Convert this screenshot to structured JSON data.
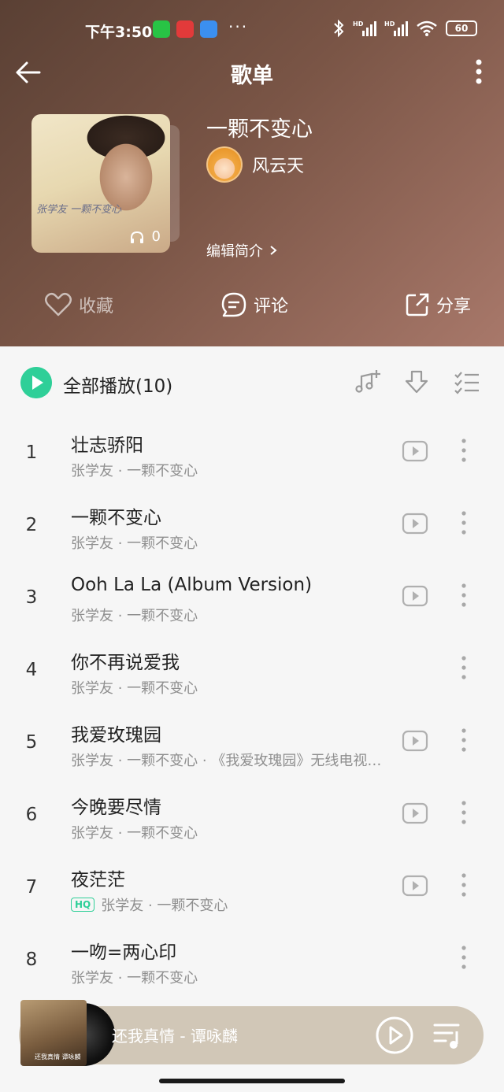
{
  "status": {
    "time": "下午3:50",
    "dots": "···",
    "battery": "60",
    "hd_label": "HD"
  },
  "nav": {
    "title": "歌单"
  },
  "playlist": {
    "title": "一颗不变心",
    "creator": "风云天",
    "edit_intro": "编辑简介",
    "listen_count": "0",
    "cover_sign": "张学友 一颗不变心"
  },
  "actions": {
    "favorite": "收藏",
    "comment": "评论",
    "share": "分享"
  },
  "play_all": {
    "label": "全部播放(10)"
  },
  "songs": [
    {
      "index": "1",
      "title": "壮志骄阳",
      "subtitle": "张学友 · 一颗不变心",
      "hq": false,
      "has_mv": true
    },
    {
      "index": "2",
      "title": "一颗不变心",
      "subtitle": "张学友 · 一颗不变心",
      "hq": false,
      "has_mv": true
    },
    {
      "index": "3",
      "title": "Ooh La La (Album Version)",
      "subtitle": "张学友 · 一颗不变心",
      "hq": false,
      "has_mv": true
    },
    {
      "index": "4",
      "title": "你不再说爱我",
      "subtitle": "张学友 · 一颗不变心",
      "hq": false,
      "has_mv": false
    },
    {
      "index": "5",
      "title": "我爱玫瑰园",
      "subtitle": "张学友 · 一颗不变心 · 《我爱玫瑰园》无线电视…",
      "hq": false,
      "has_mv": true
    },
    {
      "index": "6",
      "title": "今晚要尽情",
      "subtitle": "张学友 · 一颗不变心",
      "hq": false,
      "has_mv": true
    },
    {
      "index": "7",
      "title": "夜茫茫",
      "subtitle": "张学友 · 一颗不变心",
      "hq": true,
      "hq_label": "HQ",
      "has_mv": true
    },
    {
      "index": "8",
      "title": "一吻=两心印",
      "subtitle": "张学友 · 一颗不变心",
      "hq": false,
      "has_mv": false
    }
  ],
  "mini_player": {
    "track": "还我真情 - 谭咏麟",
    "cover_sign": "还我真情 谭咏麟"
  },
  "colors": {
    "accent": "#2fcf98",
    "header_dark": "#5a4034",
    "header_light": "#a8786a",
    "mini_player_bg": "#d1c7b7"
  },
  "icons": {
    "back": "arrow-left-icon",
    "more": "more-vertical-icon",
    "favorite": "heart-icon",
    "comment": "comment-icon",
    "share": "share-icon",
    "play_all": "play-circle-icon",
    "add_music": "music-add-icon",
    "download": "download-icon",
    "multi_select": "checklist-icon",
    "mv": "video-play-icon",
    "song_more": "more-vertical-icon",
    "mini_play": "play-circle-outline-icon",
    "playlist": "playlist-icon"
  }
}
